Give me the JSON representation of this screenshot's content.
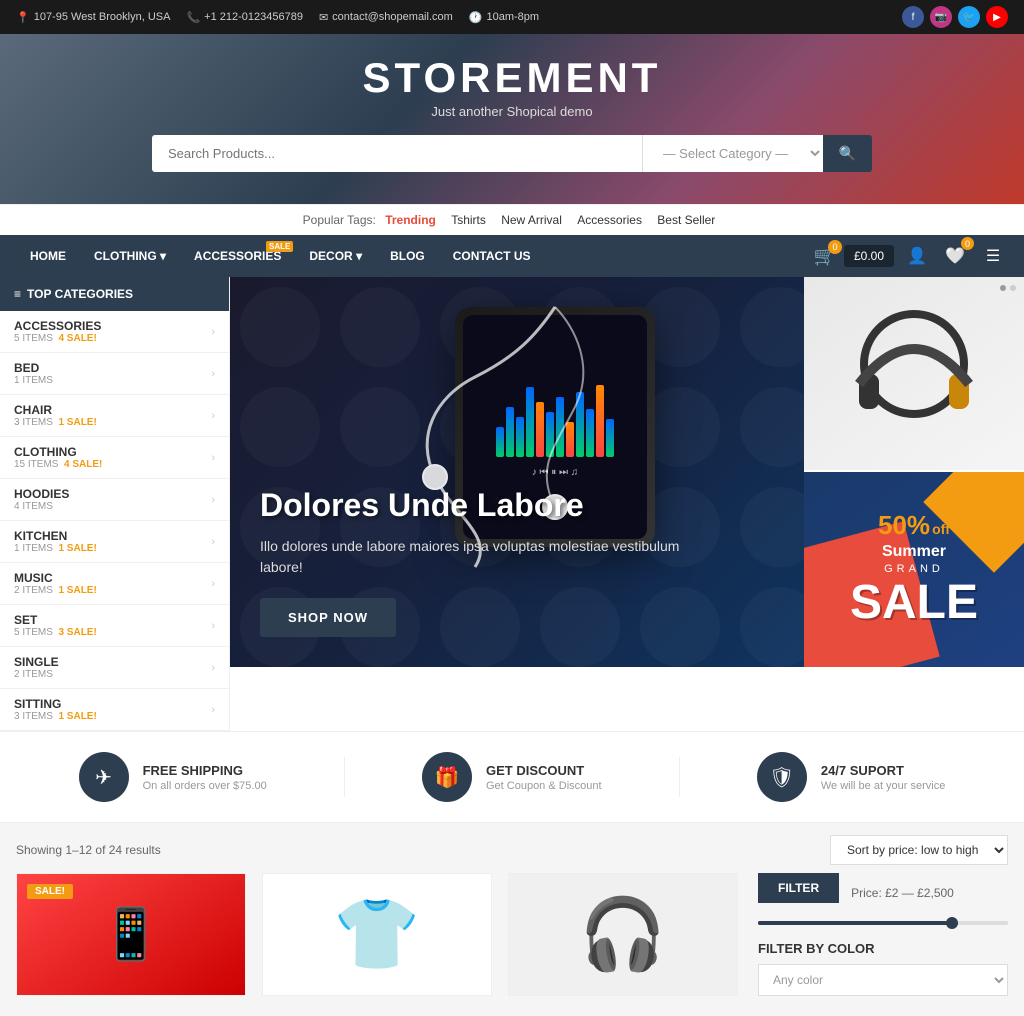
{
  "topbar": {
    "address": "107-95 West Brooklyn, USA",
    "phone": "+1 212-0123456789",
    "email": "contact@shopemail.com",
    "hours": "10am-8pm"
  },
  "header": {
    "store_name": "STOREMENT",
    "tagline": "Just another Shopical demo"
  },
  "search": {
    "placeholder": "Search Products...",
    "category_default": "— Select Category —",
    "btn_icon": "🔍"
  },
  "popular_tags": {
    "label": "Popular Tags:",
    "tags": [
      {
        "label": "Trending",
        "active": true
      },
      {
        "label": "Tshirts",
        "active": false
      },
      {
        "label": "New Arrival",
        "active": false
      },
      {
        "label": "Accessories",
        "active": false
      },
      {
        "label": "Best Seller",
        "active": false
      }
    ]
  },
  "nav": {
    "items": [
      {
        "label": "HOME",
        "has_sale": false,
        "has_dropdown": false
      },
      {
        "label": "CLOTHING",
        "has_sale": false,
        "has_dropdown": true
      },
      {
        "label": "ACCESSORIES",
        "has_sale": true,
        "sale_label": "SALE",
        "has_dropdown": false
      },
      {
        "label": "DECOR",
        "has_sale": false,
        "has_dropdown": true
      },
      {
        "label": "BLOG",
        "has_sale": false,
        "has_dropdown": false
      },
      {
        "label": "CONTACT US",
        "has_sale": false,
        "has_dropdown": false
      }
    ],
    "cart_count": "0",
    "cart_total": "£0.00",
    "wishlist_count": "0"
  },
  "sidebar": {
    "header": "TOP CATEGORIES",
    "categories": [
      {
        "name": "ACCESSORIES",
        "items": "5 ITEMS",
        "sale": "4 SALE!"
      },
      {
        "name": "BED",
        "items": "1 ITEMS",
        "sale": ""
      },
      {
        "name": "CHAIR",
        "items": "3 ITEMS",
        "sale": "1 SALE!"
      },
      {
        "name": "CLOTHING",
        "items": "15 ITEMS",
        "sale": "4 SALE!"
      },
      {
        "name": "HOODIES",
        "items": "4 ITEMS",
        "sale": ""
      },
      {
        "name": "KITCHEN",
        "items": "1 ITEMS",
        "sale": "1 SALE!"
      },
      {
        "name": "MUSIC",
        "items": "2 ITEMS",
        "sale": "1 SALE!"
      },
      {
        "name": "SET",
        "items": "5 ITEMS",
        "sale": "3 SALE!"
      },
      {
        "name": "SINGLE",
        "items": "2 ITEMS",
        "sale": ""
      },
      {
        "name": "SITTING",
        "items": "3 ITEMS",
        "sale": "1 SALE!"
      }
    ]
  },
  "hero": {
    "title": "Dolores Unde Labore",
    "description": "Illo dolores unde labore maiores ipsa voluptas molestiae vestibulum labore!",
    "btn_label": "SHOP NOW"
  },
  "features": [
    {
      "icon": "✈",
      "title": "FREE SHIPPING",
      "desc": "On all orders over $75.00"
    },
    {
      "icon": "🎁",
      "title": "GET DISCOUNT",
      "desc": "Get Coupon & Discount"
    },
    {
      "icon": "🛡",
      "title": "24/7 SUPORT",
      "desc": "We will be at your service"
    }
  ],
  "results": {
    "showing": "Showing 1–12 of 24 results",
    "sort_label": "Sort by price: low to high"
  },
  "filter": {
    "btn_label": "FILTER",
    "price_range": "Price: £2 — £2,500",
    "color_label": "FILTER BY COLOR",
    "color_placeholder": "Any color"
  },
  "sale_banner": {
    "percent": "50%",
    "off": "off",
    "summer": "Summer",
    "grand": "GRAND",
    "sale": "SALE"
  }
}
